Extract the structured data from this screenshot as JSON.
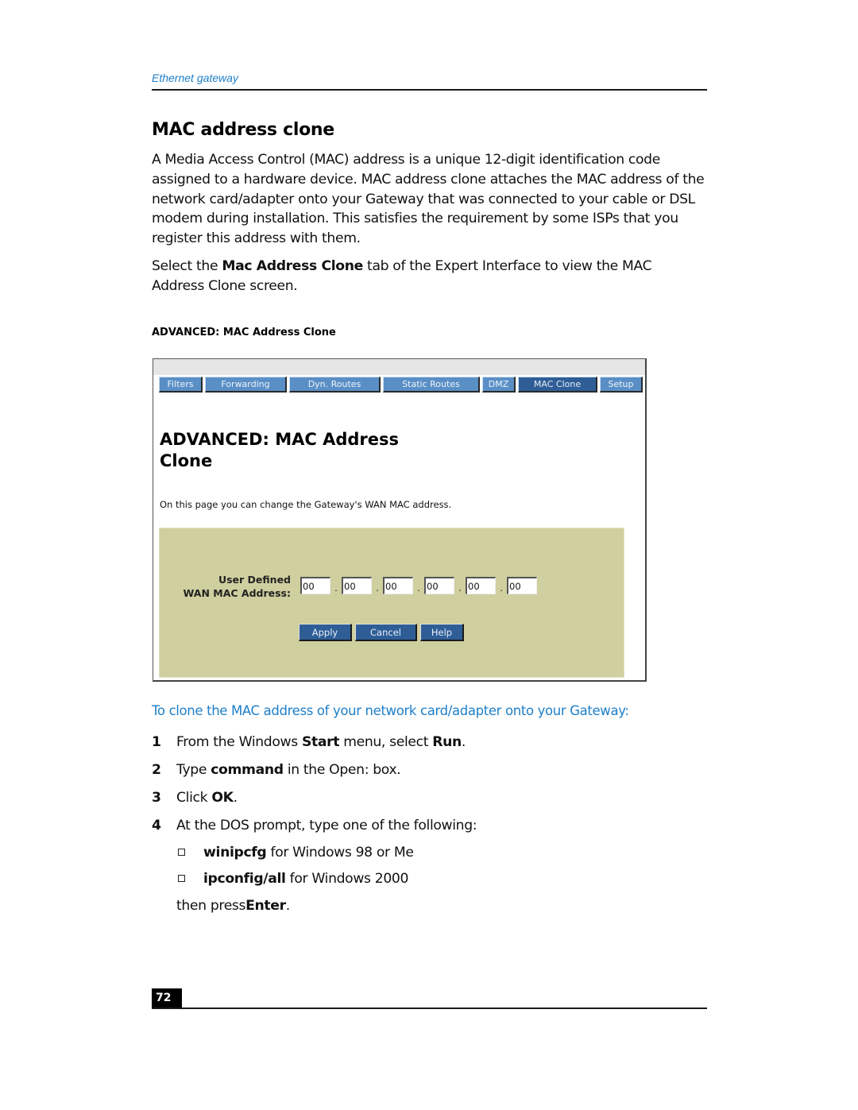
{
  "header": {
    "running_head": "Ethernet gateway"
  },
  "section": {
    "title": "MAC address clone",
    "paragraph1": "A Media Access Control (MAC) address is a unique 12-digit identification code assigned to a hardware device. MAC address clone attaches the MAC address of the network card/adapter onto your Gateway that was connected to your cable or DSL modem during installation. This satisfies the requirement by some ISPs that you register this address with them.",
    "paragraph2": {
      "pre": "Select the ",
      "bold": "Mac Address Clone",
      "post": " tab of the Expert Interface to view the MAC Address Clone screen."
    },
    "figure_caption": "ADVANCED: MAC Address Clone"
  },
  "screenshot": {
    "tabs": [
      {
        "label": "Filters",
        "active": false
      },
      {
        "label": "Forwarding",
        "active": false
      },
      {
        "label": "Dyn. Routes",
        "active": false
      },
      {
        "label": "Static Routes",
        "active": false
      },
      {
        "label": "DMZ",
        "active": false
      },
      {
        "label": "MAC Clone",
        "active": true
      },
      {
        "label": "Setup",
        "active": false
      }
    ],
    "title_line1": "ADVANCED: MAC Address",
    "title_line2": "Clone",
    "description": "On this page you can change the Gateway's WAN MAC address.",
    "mac_label_line1": "User Defined",
    "mac_label_line2": "WAN MAC Address:",
    "separator": ".",
    "octets": [
      "00",
      "00",
      "00",
      "00",
      "00",
      "00"
    ],
    "buttons": {
      "apply": "Apply",
      "cancel": "Cancel",
      "help": "Help"
    },
    "colors": {
      "tab": "#5a8fc6",
      "tab_active": "#2f5e97",
      "panel": "#cfcf9f"
    }
  },
  "procedure": {
    "title": "To clone the MAC address of your network card/adapter onto your Gateway:",
    "steps": [
      {
        "num": "1",
        "t1": "From the Windows ",
        "b1": "Start",
        "t2": " menu, select ",
        "b2": "Run",
        "t3": "."
      },
      {
        "num": "2",
        "t1": "Type ",
        "b1": "command",
        "t2": " in the Open: box.",
        "b2": "",
        "t3": ""
      },
      {
        "num": "3",
        "t1": "Click ",
        "b1": "OK",
        "t2": ".",
        "b2": "",
        "t3": ""
      },
      {
        "num": "4",
        "t1": "At the DOS prompt, type one of the following:",
        "b1": "",
        "t2": "",
        "b2": "",
        "t3": ""
      }
    ],
    "bullets": [
      {
        "bold": "winipcfg",
        "text": " for Windows 98 or Me"
      },
      {
        "bold": "ipconfig/all",
        "text": " for Windows 2000"
      }
    ],
    "tail": {
      "pre": "then press ",
      "bold": "Enter",
      "post": "."
    }
  },
  "footer": {
    "page_number": "72"
  },
  "colors": {
    "accent_blue": "#1e7fc8"
  }
}
